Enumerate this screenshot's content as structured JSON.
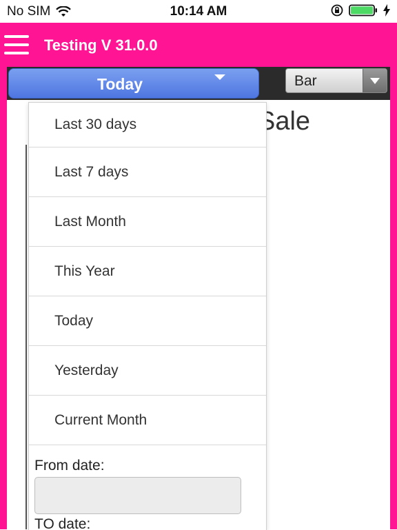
{
  "status_bar": {
    "carrier": "No SIM",
    "time": "10:14 AM",
    "icons": [
      "wifi-icon",
      "orientation-lock-icon",
      "battery-icon",
      "charging-bolt-icon"
    ],
    "battery_color": "#4cd964"
  },
  "app_bar": {
    "title": "Testing V 31.0.0",
    "background": "#ff1493",
    "menu_icon": "hamburger-menu-icon"
  },
  "filters": {
    "range_selected": "Today",
    "chart_type_selected": "Bar"
  },
  "chart": {
    "title_partial": "Sale"
  },
  "dropdown": {
    "options": [
      "Last 30 days",
      "Last 7 days",
      "Last Month",
      "This Year",
      "Today",
      "Yesterday",
      "Current Month"
    ],
    "from_label": "From date:",
    "from_value": "",
    "to_label": "TO date:"
  },
  "colors": {
    "accent": "#ff1493",
    "select_blue": "#5a82e6"
  }
}
